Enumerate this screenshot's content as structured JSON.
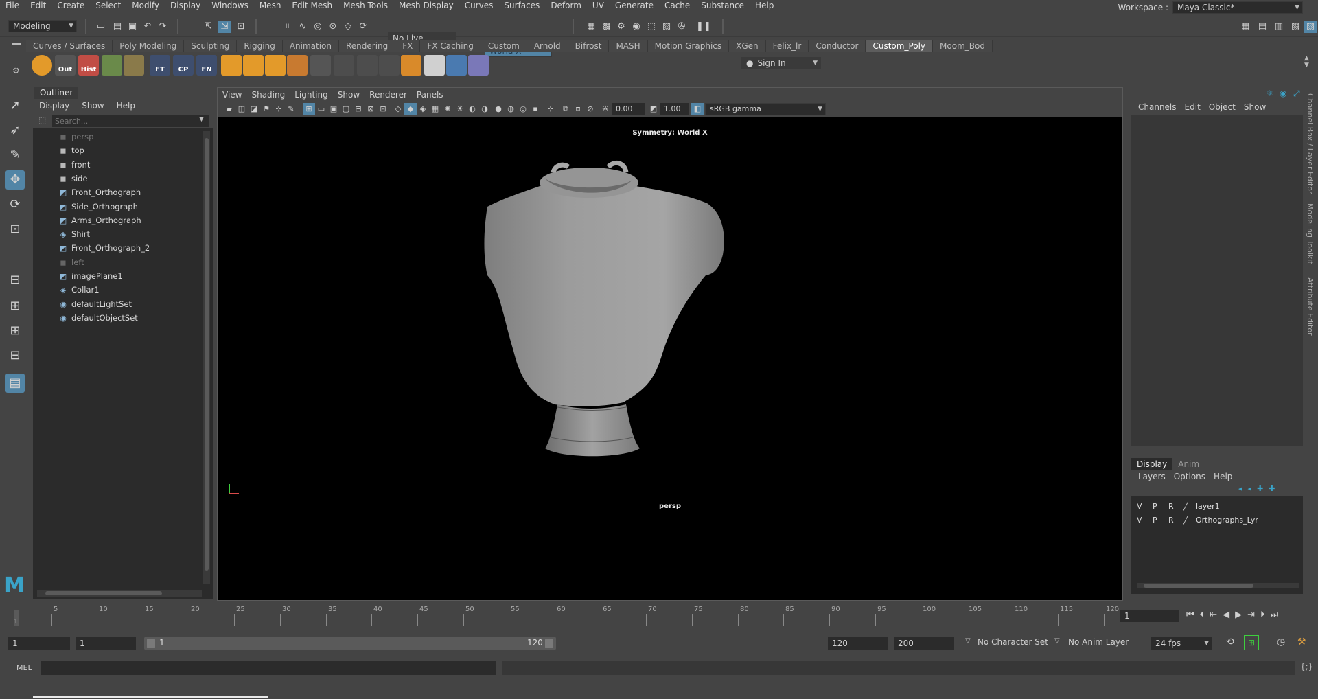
{
  "menubar": {
    "items": [
      "File",
      "Edit",
      "Create",
      "Select",
      "Modify",
      "Display",
      "Windows",
      "Mesh",
      "Edit Mesh",
      "Mesh Tools",
      "Mesh Display",
      "Curves",
      "Surfaces",
      "Deform",
      "UV",
      "Generate",
      "Cache",
      "Substance",
      "Help"
    ],
    "workspace_label": "Workspace :",
    "workspace_value": "Maya Classic*"
  },
  "statusline": {
    "mode": "Modeling",
    "live_surface": "No Live Surface",
    "symmetry": "World X",
    "sign_in": "Sign In"
  },
  "shelf": {
    "tabs": [
      "Curves / Surfaces",
      "Poly Modeling",
      "Sculpting",
      "Rigging",
      "Animation",
      "Rendering",
      "FX",
      "FX Caching",
      "Custom",
      "Arnold",
      "Bifrost",
      "MASH",
      "Motion Graphics",
      "XGen",
      "Felix_lr",
      "Conductor",
      "Custom_Poly",
      "Moom_Bod"
    ],
    "active_tab": "Custom_Poly",
    "icons": [
      {
        "name": "poly-cube-shelf-icon",
        "label": ""
      },
      {
        "name": "out-shelf-icon",
        "label": "Out"
      },
      {
        "name": "hist-shelf-icon",
        "label": "Hist"
      },
      {
        "name": "uv-grid-shelf-icon",
        "label": ""
      },
      {
        "name": "uv-checker-shelf-icon",
        "label": ""
      },
      {
        "name": "ft-shelf-icon",
        "label": "FT"
      },
      {
        "name": "cp-shelf-icon",
        "label": "CP"
      },
      {
        "name": "fn-shelf-icon",
        "label": "FN"
      }
    ]
  },
  "outliner": {
    "title": "Outliner",
    "menus": [
      "Display",
      "Show",
      "Help"
    ],
    "search_placeholder": "Search...",
    "items": [
      {
        "label": "persp",
        "icon": "camera-icon",
        "dim": true
      },
      {
        "label": "top",
        "icon": "camera-icon",
        "dim": false
      },
      {
        "label": "front",
        "icon": "camera-icon",
        "dim": false
      },
      {
        "label": "side",
        "icon": "camera-icon",
        "dim": false
      },
      {
        "label": "Front_Orthograph",
        "icon": "image-plane-icon",
        "dim": false
      },
      {
        "label": "Side_Orthograph",
        "icon": "image-plane-icon",
        "dim": false
      },
      {
        "label": "Arms_Orthograph",
        "icon": "image-plane-icon",
        "dim": false
      },
      {
        "label": "Shirt",
        "icon": "mesh-icon",
        "dim": false
      },
      {
        "label": "Front_Orthograph_2",
        "icon": "image-plane-icon",
        "dim": false
      },
      {
        "label": "left",
        "icon": "camera-icon",
        "dim": true
      },
      {
        "label": "imagePlane1",
        "icon": "image-plane-icon",
        "dim": false
      },
      {
        "label": "Collar1",
        "icon": "mesh-icon",
        "dim": false
      },
      {
        "label": "defaultLightSet",
        "icon": "set-icon",
        "dim": false
      },
      {
        "label": "defaultObjectSet",
        "icon": "set-icon",
        "dim": false
      }
    ]
  },
  "viewport": {
    "menus": [
      "View",
      "Shading",
      "Lighting",
      "Show",
      "Renderer",
      "Panels"
    ],
    "exposure": "0.00",
    "gamma": "1.00",
    "colorspace": "sRGB gamma",
    "symmetry_label": "Symmetry: World X",
    "camera_label": "persp"
  },
  "channelbox": {
    "menus": [
      "Channels",
      "Edit",
      "Object",
      "Show"
    ]
  },
  "layer_editor": {
    "tabs": [
      "Display",
      "Anim"
    ],
    "menus": [
      "Layers",
      "Options",
      "Help"
    ],
    "layers": [
      {
        "v": "V",
        "p": "P",
        "r": "R",
        "name": "layer1"
      },
      {
        "v": "V",
        "p": "P",
        "r": "R",
        "name": "Orthographs_Lyr"
      }
    ]
  },
  "side_tabs": [
    "Channel Box / Layer Editor",
    "Modeling Toolkit",
    "Attribute Editor"
  ],
  "timeline": {
    "ticks": [
      "5",
      "10",
      "15",
      "20",
      "25",
      "30",
      "35",
      "40",
      "45",
      "50",
      "55",
      "60",
      "65",
      "70",
      "75",
      "80",
      "85",
      "90",
      "95",
      "100",
      "105",
      "110",
      "115",
      "120"
    ],
    "current_frame_marker": "1",
    "current_frame": "1"
  },
  "range": {
    "start": "1",
    "anim_start": "1",
    "slider_start": "1",
    "slider_end": "120",
    "end": "120",
    "anim_end": "200",
    "character_set": "No Character Set",
    "anim_layer": "No Anim Layer",
    "fps": "24 fps"
  },
  "commandline": {
    "language": "MEL"
  }
}
